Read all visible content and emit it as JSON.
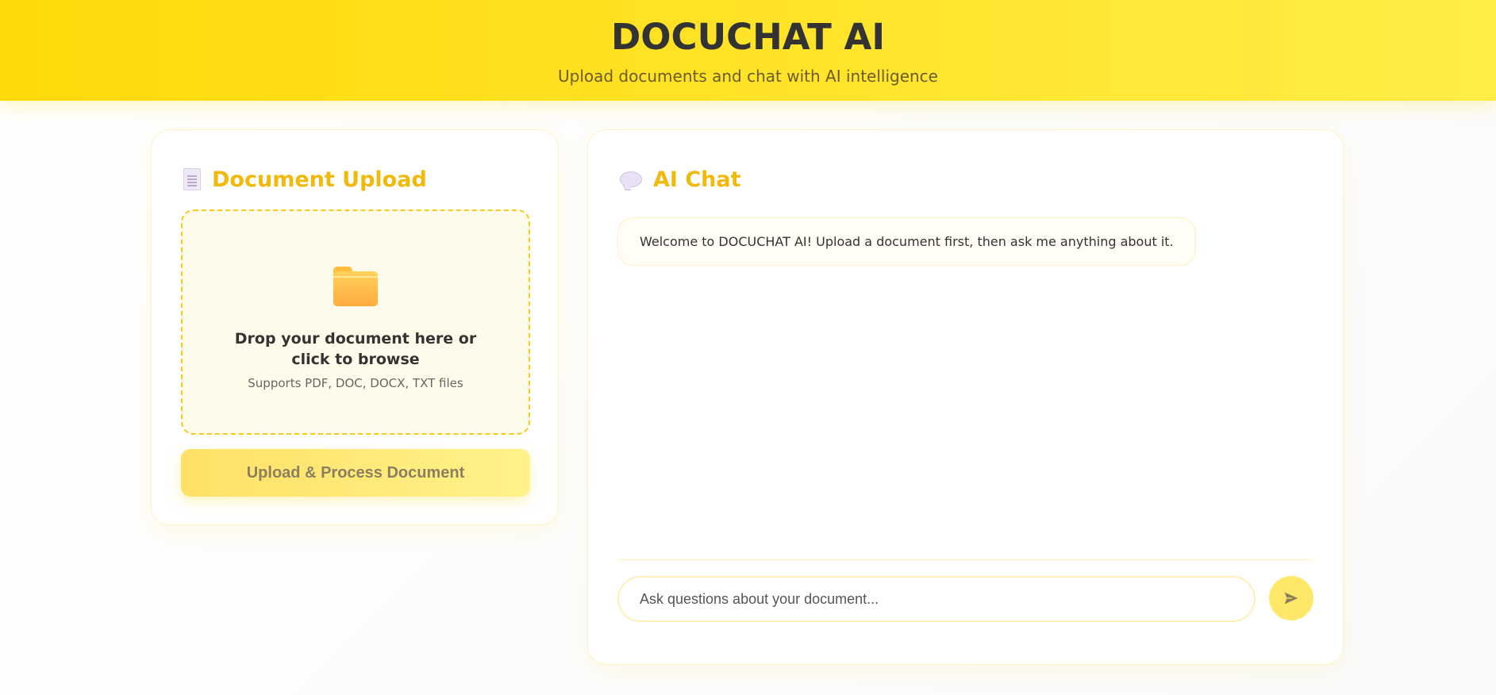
{
  "header": {
    "title": "DOCUCHAT AI",
    "subtitle": "Upload documents and chat with AI intelligence"
  },
  "upload": {
    "title": "Document Upload",
    "icon": "document-icon",
    "dropzone": {
      "icon": "folder-icon",
      "title": "Drop your document here or click to browse",
      "subtitle": "Supports PDF, DOC, DOCX, TXT files"
    },
    "button_label": "Upload & Process Document"
  },
  "chat": {
    "title": "AI Chat",
    "icon": "speech-bubble-icon",
    "messages": [
      {
        "text": "Welcome to DOCUCHAT AI! Upload a document first, then ask me anything about it."
      }
    ],
    "input_value": "",
    "input_placeholder": "Ask questions about your document...",
    "send_icon": "send-arrow-icon"
  },
  "colors": {
    "header_bg": "#ffdd1a",
    "accent": "#f0b90b",
    "dropzone_border": "#f5cc1b",
    "button_bg": "#ffe066"
  }
}
